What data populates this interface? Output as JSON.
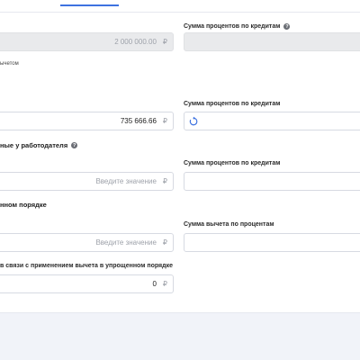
{
  "tabs": {
    "active_indicator": "active-tab"
  },
  "rows": [
    {
      "left_value": "2 000 000.00",
      "currency": "₽",
      "right_label": "Сумма процентов по кредитам"
    },
    {
      "note": "ычетом"
    },
    {
      "left_value": "735 666.66",
      "currency": "₽",
      "right_label": "Сумма процентов по кредитам",
      "right_icon": "refresh-icon"
    },
    {
      "heading": "ные у работодателя",
      "left_placeholder": "Введите значение",
      "currency": "₽",
      "right_label": "Сумма процентов по кредитам"
    },
    {
      "heading": "нном порядке",
      "left_placeholder": "Введите значение",
      "currency": "₽",
      "right_label": "Сумма вычета по процентам"
    },
    {
      "label": "в связи с применением вычета в упрощенном порядке",
      "left_value": "0",
      "currency": "₽"
    }
  ],
  "colors": {
    "accent": "#3d72e0",
    "help": "#6b6e75"
  }
}
